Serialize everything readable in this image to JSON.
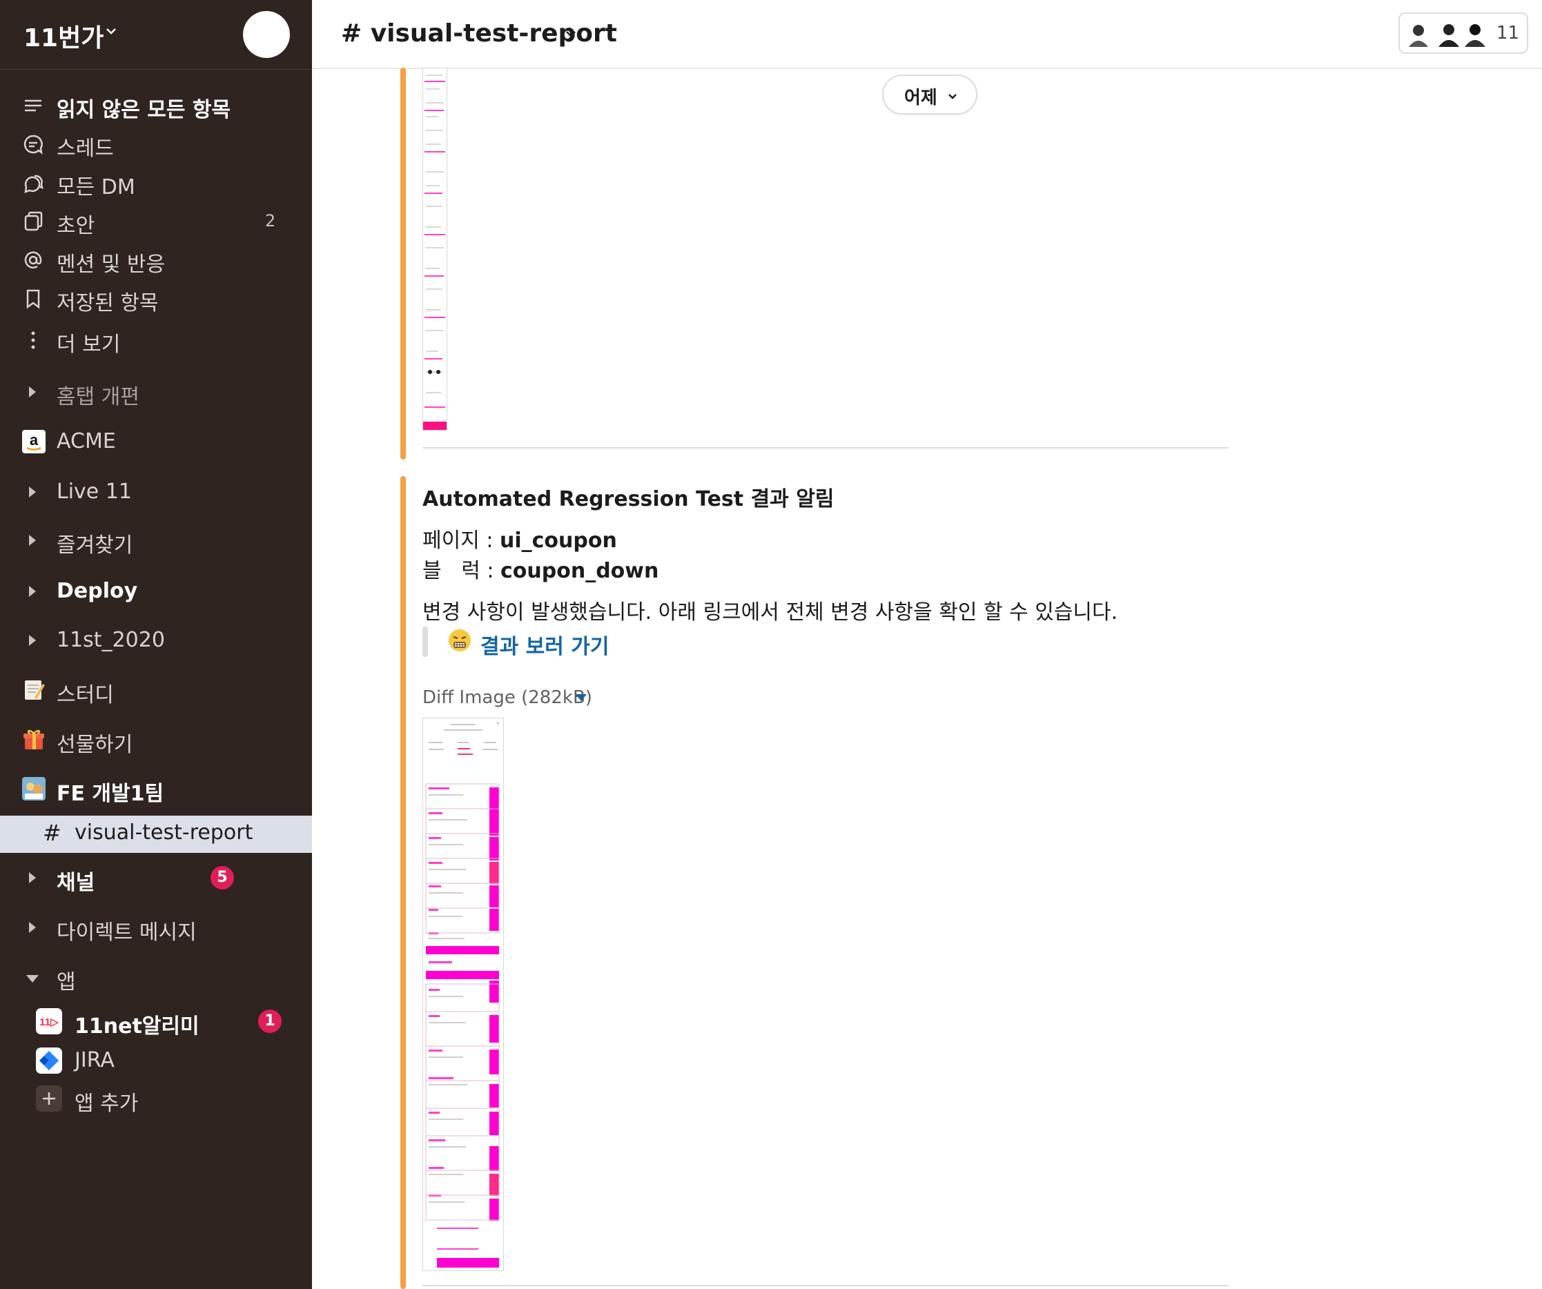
{
  "workspace": {
    "name": "11번가"
  },
  "sidebar": {
    "top_items": [
      {
        "label": "읽지 않은 모든 항목",
        "icon": "unread-icon"
      },
      {
        "label": "스레드",
        "icon": "threads-icon"
      },
      {
        "label": "모든 DM",
        "icon": "dm-icon"
      },
      {
        "label": "초안",
        "icon": "drafts-icon",
        "count": "2"
      },
      {
        "label": "멘션 및 반응",
        "icon": "at-icon"
      },
      {
        "label": "저장된 항목",
        "icon": "bookmark-icon"
      },
      {
        "label": "더 보기",
        "icon": "more-icon"
      }
    ],
    "sections": [
      {
        "label": "홈탭 개편"
      },
      {
        "label": "ACME",
        "icon": "amazon-icon"
      },
      {
        "label": "Live 11"
      },
      {
        "label": "즐겨찾기"
      },
      {
        "label": "Deploy"
      },
      {
        "label": "11st_2020"
      },
      {
        "label": "스터디",
        "icon": "memo-emoji-icon"
      },
      {
        "label": "선물하기",
        "icon": "gift-emoji-icon"
      },
      {
        "label": "FE 개발1팀",
        "icon": "team-emoji-icon"
      }
    ],
    "active_channel": {
      "hash": "#",
      "label": "visual-test-report"
    },
    "channels": {
      "label": "채널",
      "badge": "5"
    },
    "dms": {
      "label": "다이렉트 메시지"
    },
    "apps": {
      "label": "앱",
      "items": [
        {
          "label": "11net알리미",
          "icon": "11st-app-icon",
          "badge": "1"
        },
        {
          "label": "JIRA",
          "icon": "jira-icon"
        },
        {
          "label": "앱 추가",
          "icon": "plus-icon"
        }
      ]
    }
  },
  "header": {
    "channel_title": "# visual-test-report",
    "member_count": "11"
  },
  "date_divider": {
    "label": "어제"
  },
  "message": {
    "title": "Automated Regression Test 결과 알림",
    "page_key": "페이지 : ",
    "page_value": "ui_coupon",
    "block_key": "블   럭 : ",
    "block_value": "coupon_down",
    "body": "변경 사항이 발생했습니다. 아래 링크에서 전체 변경 사항을 확인 할 수 있습니다.",
    "link_text": "결과 보러 가기",
    "attachment_label": "Diff Image (282kB)"
  },
  "colors": {
    "sidebar_bg": "#2f2420",
    "accent_orange": "#f6a045",
    "link_blue": "#1264a3",
    "badge_red": "#e01e5a",
    "diff_magenta": "#ff00d0"
  }
}
